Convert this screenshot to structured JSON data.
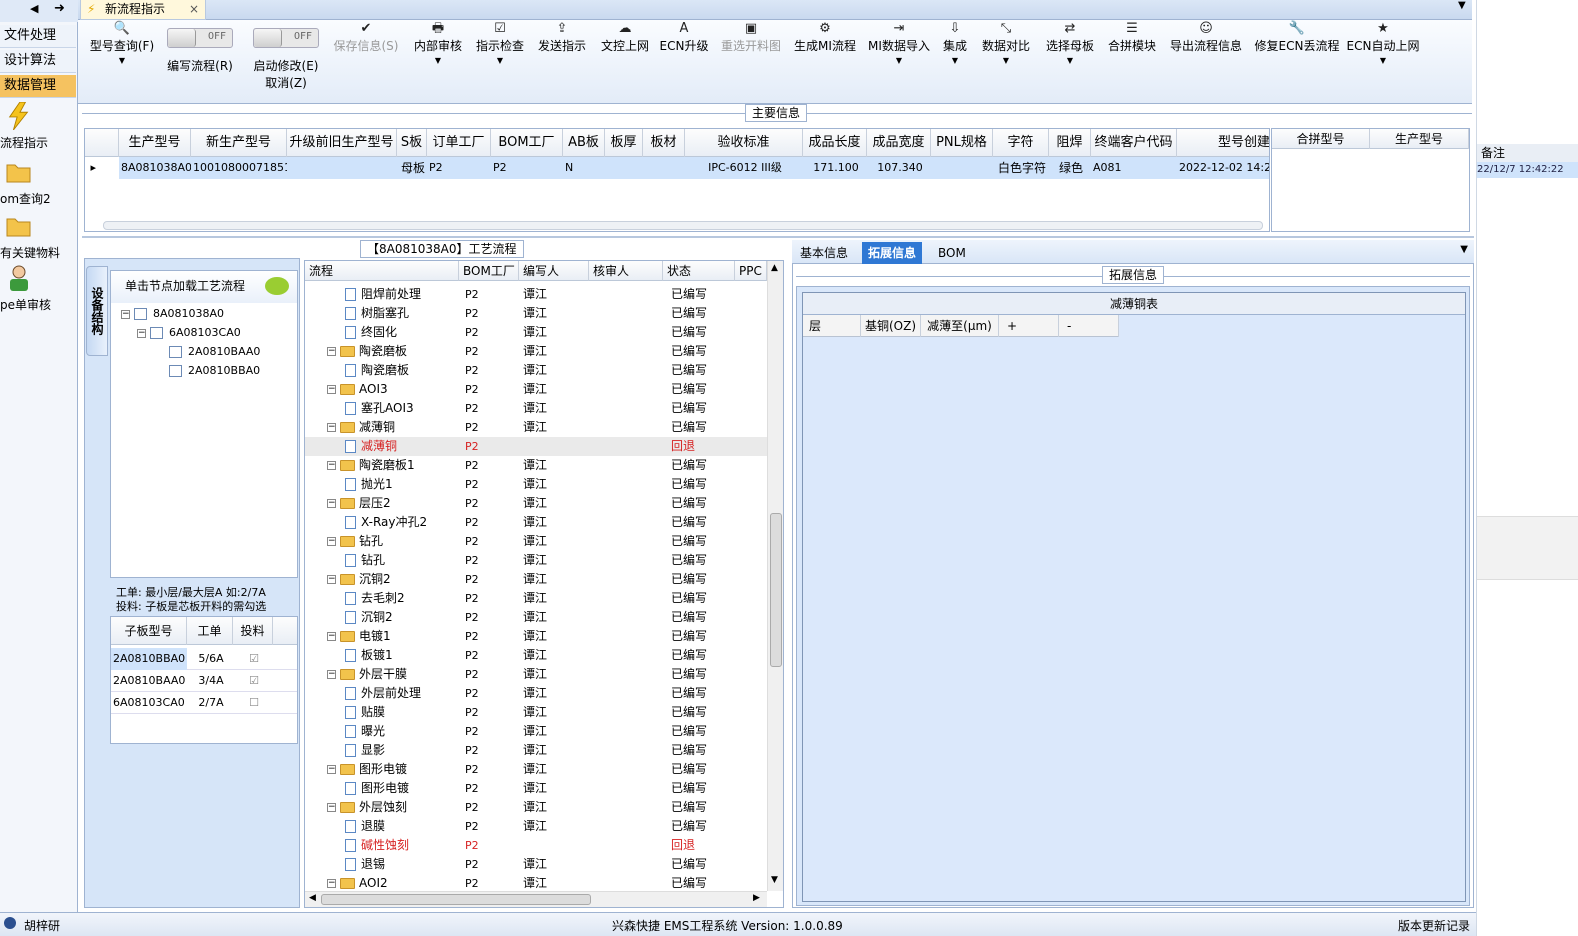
{
  "window": {
    "doc_tab_title": "新流程指示"
  },
  "nav": {
    "tabs": [
      "文件处理",
      "设计算法",
      "数据管理"
    ],
    "items": [
      "流程指示",
      "om查询2",
      "有关键物料",
      "pe单审核"
    ]
  },
  "toolbar": {
    "model_query": "型号查询(F)",
    "edit_flow": "编写流程(R)",
    "edit_toggle": "OFF",
    "start_modify": "启动修改(E)",
    "start_modify_toggle": "OFF",
    "cancel": "取消(Z)",
    "save_info": "保存信息(S)",
    "internal_review": "内部审核",
    "check_instruction": "指示检查",
    "send_instruction": "发送指示",
    "doc_control": "文控上网",
    "ecn_upgrade": "ECN升级",
    "reselect_cut": "重选开料图",
    "gen_mi_flow": "生成MI流程",
    "mi_import": "MI数据导入",
    "integrate": "集成",
    "data_compare": "数据对比",
    "select_mother": "选择母板",
    "merge_module": "合拼模块",
    "export_flow": "导出流程信息",
    "repair_ecn": "修复ECN丢流程",
    "ecn_auto": "ECN自动上网"
  },
  "main_info": {
    "title": "主要信息",
    "columns": [
      "生产型号",
      "新生产型号",
      "升级前旧生产型号",
      "S板",
      "订单工厂",
      "BOM工厂",
      "AB板",
      "板厚",
      "板材",
      "验收标准",
      "成品长度",
      "成品宽度",
      "PNL规格",
      "字符",
      "阻焊",
      "终端客户代码",
      "型号创建"
    ],
    "row": [
      "8A081038A0",
      "10010800071851",
      "",
      "母板",
      "P2",
      "P2",
      "N",
      "",
      "",
      "IPC-6012 III级",
      "171.100",
      "107.340",
      "",
      "白色字符",
      "绿色",
      "A081",
      "2022-12-02 14:26"
    ],
    "merge_columns": [
      "合拼型号",
      "生产型号"
    ]
  },
  "far_right": {
    "header": "备注",
    "value": "22/12/7 12:42:22"
  },
  "flow_panel": {
    "title": "【8A081038A0】工艺流程"
  },
  "structure": {
    "vtab": "设备结构",
    "hint": "单击节点加载工艺流程",
    "tree": [
      "8A081038A0",
      "6A08103CA0",
      "2A0810BAA0",
      "2A0810BBA0"
    ],
    "note_line1": "工单: 最小层/最大层A 如:2/7A",
    "note_line2": "投料: 子板是芯板开料的需勾选",
    "sub_columns": [
      "子板型号",
      "工单",
      "投料"
    ],
    "sub_rows": [
      {
        "model": "2A0810BBA0",
        "order": "5/6A",
        "feed": "checked"
      },
      {
        "model": "2A0810BAA0",
        "order": "3/4A",
        "feed": "checked"
      },
      {
        "model": "6A08103CA0",
        "order": "2/7A",
        "feed": "unchecked"
      }
    ]
  },
  "flow_grid": {
    "columns": [
      "流程",
      "BOM工厂",
      "编写人",
      "核审人",
      "状态",
      "PPC"
    ],
    "rows": [
      {
        "name": "阻焊前处理",
        "level": 2,
        "bom": "P2",
        "writer": "谭江",
        "status": "已编写"
      },
      {
        "name": "树脂塞孔",
        "level": 2,
        "bom": "P2",
        "writer": "谭江",
        "status": "已编写"
      },
      {
        "name": "终固化",
        "level": 2,
        "bom": "P2",
        "writer": "谭江",
        "status": "已编写"
      },
      {
        "name": "陶瓷磨板",
        "level": 1,
        "bom": "P2",
        "writer": "谭江",
        "status": "已编写"
      },
      {
        "name": "陶瓷磨板",
        "level": 2,
        "bom": "P2",
        "writer": "谭江",
        "status": "已编写"
      },
      {
        "name": "AOI3",
        "level": 1,
        "bom": "P2",
        "writer": "谭江",
        "status": "已编写"
      },
      {
        "name": "塞孔AOI3",
        "level": 2,
        "bom": "P2",
        "writer": "谭江",
        "status": "已编写"
      },
      {
        "name": "减薄铜",
        "level": 1,
        "bom": "P2",
        "writer": "谭江",
        "status": "已编写"
      },
      {
        "name": "减薄铜",
        "level": 2,
        "bom": "P2",
        "writer": "",
        "status": "回退",
        "red": true,
        "sel": true
      },
      {
        "name": "陶瓷磨板1",
        "level": 1,
        "bom": "P2",
        "writer": "谭江",
        "status": "已编写"
      },
      {
        "name": "抛光1",
        "level": 2,
        "bom": "P2",
        "writer": "谭江",
        "status": "已编写"
      },
      {
        "name": "层压2",
        "level": 1,
        "bom": "P2",
        "writer": "谭江",
        "status": "已编写"
      },
      {
        "name": "X-Ray冲孔2",
        "level": 2,
        "bom": "P2",
        "writer": "谭江",
        "status": "已编写"
      },
      {
        "name": "钻孔",
        "level": 1,
        "bom": "P2",
        "writer": "谭江",
        "status": "已编写"
      },
      {
        "name": "钻孔",
        "level": 2,
        "bom": "P2",
        "writer": "谭江",
        "status": "已编写"
      },
      {
        "name": "沉铜2",
        "level": 1,
        "bom": "P2",
        "writer": "谭江",
        "status": "已编写"
      },
      {
        "name": "去毛刺2",
        "level": 2,
        "bom": "P2",
        "writer": "谭江",
        "status": "已编写"
      },
      {
        "name": "沉铜2",
        "level": 2,
        "bom": "P2",
        "writer": "谭江",
        "status": "已编写"
      },
      {
        "name": "电镀1",
        "level": 1,
        "bom": "P2",
        "writer": "谭江",
        "status": "已编写"
      },
      {
        "name": "板镀1",
        "level": 2,
        "bom": "P2",
        "writer": "谭江",
        "status": "已编写"
      },
      {
        "name": "外层干膜",
        "level": 1,
        "bom": "P2",
        "writer": "谭江",
        "status": "已编写"
      },
      {
        "name": "外层前处理",
        "level": 2,
        "bom": "P2",
        "writer": "谭江",
        "status": "已编写"
      },
      {
        "name": "贴膜",
        "level": 2,
        "bom": "P2",
        "writer": "谭江",
        "status": "已编写"
      },
      {
        "name": "曝光",
        "level": 2,
        "bom": "P2",
        "writer": "谭江",
        "status": "已编写"
      },
      {
        "name": "显影",
        "level": 2,
        "bom": "P2",
        "writer": "谭江",
        "status": "已编写"
      },
      {
        "name": "图形电镀",
        "level": 1,
        "bom": "P2",
        "writer": "谭江",
        "status": "已编写"
      },
      {
        "name": "图形电镀",
        "level": 2,
        "bom": "P2",
        "writer": "谭江",
        "status": "已编写"
      },
      {
        "name": "外层蚀刻",
        "level": 1,
        "bom": "P2",
        "writer": "谭江",
        "status": "已编写"
      },
      {
        "name": "退膜",
        "level": 2,
        "bom": "P2",
        "writer": "谭江",
        "status": "已编写"
      },
      {
        "name": "碱性蚀刻",
        "level": 2,
        "bom": "P2",
        "writer": "",
        "status": "回退",
        "red": true
      },
      {
        "name": "退锡",
        "level": 2,
        "bom": "P2",
        "writer": "谭江",
        "status": "已编写"
      },
      {
        "name": "AOI2",
        "level": 1,
        "bom": "P2",
        "writer": "谭江",
        "status": "已编写"
      }
    ]
  },
  "right_panel": {
    "tabs": [
      "基本信息",
      "拓展信息",
      "BOM"
    ],
    "active_tab": "拓展信息",
    "group_title": "拓展信息",
    "table_title": "减薄铜表",
    "table_columns": [
      "层",
      "基铜(OZ)",
      "减薄至(μm)",
      "+",
      "-"
    ]
  },
  "status_bar": {
    "user": "胡梓研",
    "app": "兴森快捷 EMS工程系统 Version: 1.0.0.89",
    "log": "版本更新记录"
  },
  "colors": {
    "accent": "#f5c260",
    "selected_tab": "#2f78d4",
    "returned": "#d62222",
    "row_highlight": "#cfe3fb"
  }
}
